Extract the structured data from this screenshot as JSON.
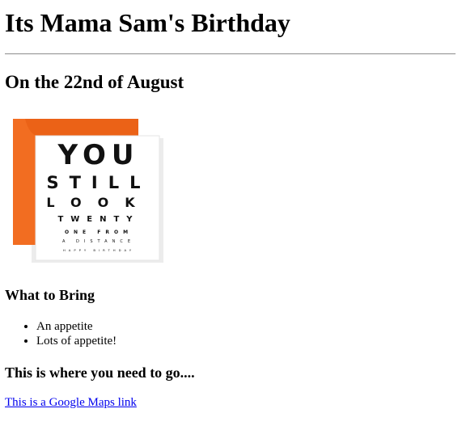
{
  "page": {
    "title": "Its Mama Sam's Birthday",
    "subtitle": "On the 22nd of August"
  },
  "card_image": {
    "description_icon": "birthday-card-image",
    "colors": {
      "envelope": "#f26d21",
      "card": "#ffffff",
      "text": "#111111"
    },
    "lines": [
      "YOU",
      "STILL",
      "LOOK",
      "TWENTY",
      "ONE FROM",
      "A DISTANCE",
      "HAPPY BIRTHDAY"
    ]
  },
  "bring": {
    "heading": "What to Bring",
    "items": [
      "An appetite",
      "Lots of appetite!"
    ]
  },
  "location": {
    "heading": "This is where you need to go....",
    "link_text": "This is a Google Maps link",
    "link_color": "#0000ee"
  }
}
